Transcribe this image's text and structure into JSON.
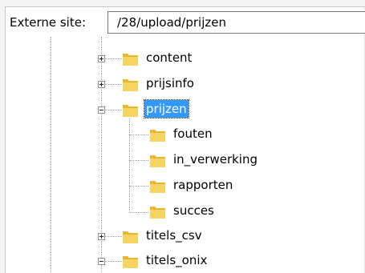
{
  "site_bar": {
    "label": "Externe site:",
    "path": "/28/upload/prijzen"
  },
  "tree": {
    "items": [
      {
        "label": "content",
        "expanded": false,
        "level": 1,
        "selected": false
      },
      {
        "label": "prijsinfo",
        "expanded": false,
        "level": 1,
        "selected": false
      },
      {
        "label": "prijzen",
        "expanded": true,
        "level": 1,
        "selected": true
      },
      {
        "label": "fouten",
        "level": 2,
        "selected": false
      },
      {
        "label": "in_verwerking",
        "level": 2,
        "selected": false
      },
      {
        "label": "rapporten",
        "level": 2,
        "selected": false
      },
      {
        "label": "succes",
        "level": 2,
        "selected": false
      },
      {
        "label": "titels_csv",
        "expanded": false,
        "level": 1,
        "selected": false
      },
      {
        "label": "titels_onix",
        "expanded": true,
        "level": 1,
        "selected": false
      }
    ]
  },
  "colors": {
    "selection": "#3399ff",
    "folder": "#e8b731"
  },
  "icons": {
    "folder": "folder-icon",
    "expand": "plus-icon",
    "collapse": "minus-icon"
  }
}
